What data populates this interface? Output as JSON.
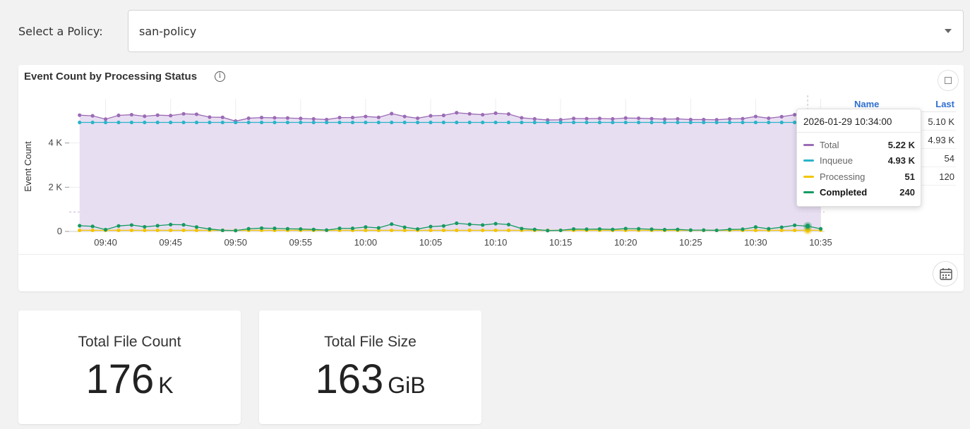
{
  "policy": {
    "label": "Select a Policy:",
    "value": "san-policy"
  },
  "chart": {
    "title": "Event Count by Processing Status",
    "info_icon": "info-circle-icon",
    "expand_icon": "expand-icon",
    "calendar_icon": "calendar-icon",
    "legend": {
      "name_header": "Name",
      "last_header": "Last",
      "rows": [
        {
          "name": "Total",
          "last": "5.10 K"
        },
        {
          "name": "Inqueue",
          "last": "4.93 K"
        },
        {
          "name": "Processing",
          "last": "54"
        },
        {
          "name": "Completed",
          "last": "120"
        }
      ]
    },
    "tooltip": {
      "time": "2026-01-29 10:34:00",
      "rows": [
        {
          "label": "Total",
          "value": "5.22 K",
          "color": "#9b6bb5"
        },
        {
          "label": "Inqueue",
          "value": "4.93 K",
          "color": "#2ab4c8"
        },
        {
          "label": "Processing",
          "value": "51",
          "color": "#f2c500"
        },
        {
          "label": "Completed",
          "value": "240",
          "color": "#169a62"
        }
      ]
    }
  },
  "chart_data": {
    "type": "line",
    "ylabel": "Event Count",
    "xlabel": "",
    "ylim": [
      0,
      6000
    ],
    "y_ticks": [
      {
        "value": 0,
        "label": "0"
      },
      {
        "value": 2000,
        "label": "2 K"
      },
      {
        "value": 4000,
        "label": "4 K"
      }
    ],
    "x_ticks": [
      "09:40",
      "09:45",
      "09:50",
      "09:55",
      "10:00",
      "10:05",
      "10:10",
      "10:15",
      "10:20",
      "10:25",
      "10:30",
      "10:35"
    ],
    "x_range": [
      "09:38",
      "10:35"
    ],
    "x_times": [
      "09:38",
      "09:39",
      "09:40",
      "09:41",
      "09:42",
      "09:43",
      "09:44",
      "09:45",
      "09:46",
      "09:47",
      "09:48",
      "09:49",
      "09:50",
      "09:51",
      "09:52",
      "09:53",
      "09:54",
      "09:55",
      "09:56",
      "09:57",
      "09:58",
      "09:59",
      "10:00",
      "10:01",
      "10:02",
      "10:03",
      "10:04",
      "10:05",
      "10:06",
      "10:07",
      "10:08",
      "10:09",
      "10:10",
      "10:11",
      "10:12",
      "10:13",
      "10:14",
      "10:15",
      "10:16",
      "10:17",
      "10:18",
      "10:19",
      "10:20",
      "10:21",
      "10:22",
      "10:23",
      "10:24",
      "10:25",
      "10:26",
      "10:27",
      "10:28",
      "10:29",
      "10:30",
      "10:31",
      "10:32",
      "10:33",
      "10:34",
      "10:35"
    ],
    "series": [
      {
        "name": "Total",
        "color": "#9b6bb5",
        "values": [
          5260,
          5230,
          5080,
          5250,
          5280,
          5210,
          5260,
          5240,
          5320,
          5300,
          5170,
          5160,
          4990,
          5120,
          5150,
          5140,
          5130,
          5110,
          5090,
          5060,
          5150,
          5150,
          5200,
          5160,
          5330,
          5200,
          5120,
          5230,
          5250,
          5370,
          5320,
          5280,
          5350,
          5310,
          5140,
          5090,
          5040,
          5050,
          5110,
          5100,
          5110,
          5090,
          5130,
          5120,
          5100,
          5080,
          5090,
          5060,
          5060,
          5050,
          5090,
          5100,
          5200,
          5120,
          5190,
          5280,
          5220,
          5100
        ]
      },
      {
        "name": "Inqueue",
        "color": "#2ab4c8",
        "values": [
          4930,
          4930,
          4930,
          4930,
          4930,
          4930,
          4930,
          4930,
          4930,
          4930,
          4930,
          4930,
          4930,
          4930,
          4930,
          4930,
          4930,
          4930,
          4930,
          4930,
          4930,
          4930,
          4930,
          4930,
          4930,
          4930,
          4930,
          4930,
          4930,
          4930,
          4930,
          4930,
          4930,
          4930,
          4930,
          4930,
          4930,
          4930,
          4930,
          4930,
          4930,
          4930,
          4930,
          4930,
          4930,
          4930,
          4930,
          4930,
          4930,
          4930,
          4930,
          4930,
          4930,
          4930,
          4930,
          4930,
          4930,
          4930
        ]
      },
      {
        "name": "Processing",
        "color": "#f2c500",
        "values": [
          50,
          50,
          50,
          50,
          50,
          50,
          50,
          50,
          50,
          50,
          50,
          50,
          50,
          50,
          50,
          50,
          50,
          50,
          50,
          50,
          50,
          50,
          50,
          50,
          50,
          50,
          50,
          50,
          50,
          50,
          50,
          50,
          50,
          50,
          50,
          50,
          50,
          50,
          50,
          50,
          50,
          50,
          50,
          50,
          50,
          50,
          50,
          50,
          50,
          50,
          50,
          50,
          50,
          50,
          50,
          50,
          51,
          54
        ]
      },
      {
        "name": "Completed",
        "color": "#169a62",
        "values": [
          260,
          230,
          80,
          250,
          290,
          210,
          260,
          310,
          300,
          200,
          110,
          50,
          40,
          120,
          150,
          140,
          120,
          110,
          90,
          60,
          140,
          140,
          200,
          160,
          330,
          190,
          110,
          220,
          250,
          370,
          320,
          290,
          350,
          310,
          130,
          90,
          40,
          50,
          110,
          100,
          110,
          90,
          130,
          120,
          100,
          80,
          90,
          60,
          60,
          50,
          90,
          100,
          200,
          120,
          190,
          280,
          240,
          120
        ]
      }
    ]
  },
  "stats": [
    {
      "title": "Total File Count",
      "value": "176",
      "unit": "K"
    },
    {
      "title": "Total File Size",
      "value": "163",
      "unit": "GiB"
    }
  ]
}
